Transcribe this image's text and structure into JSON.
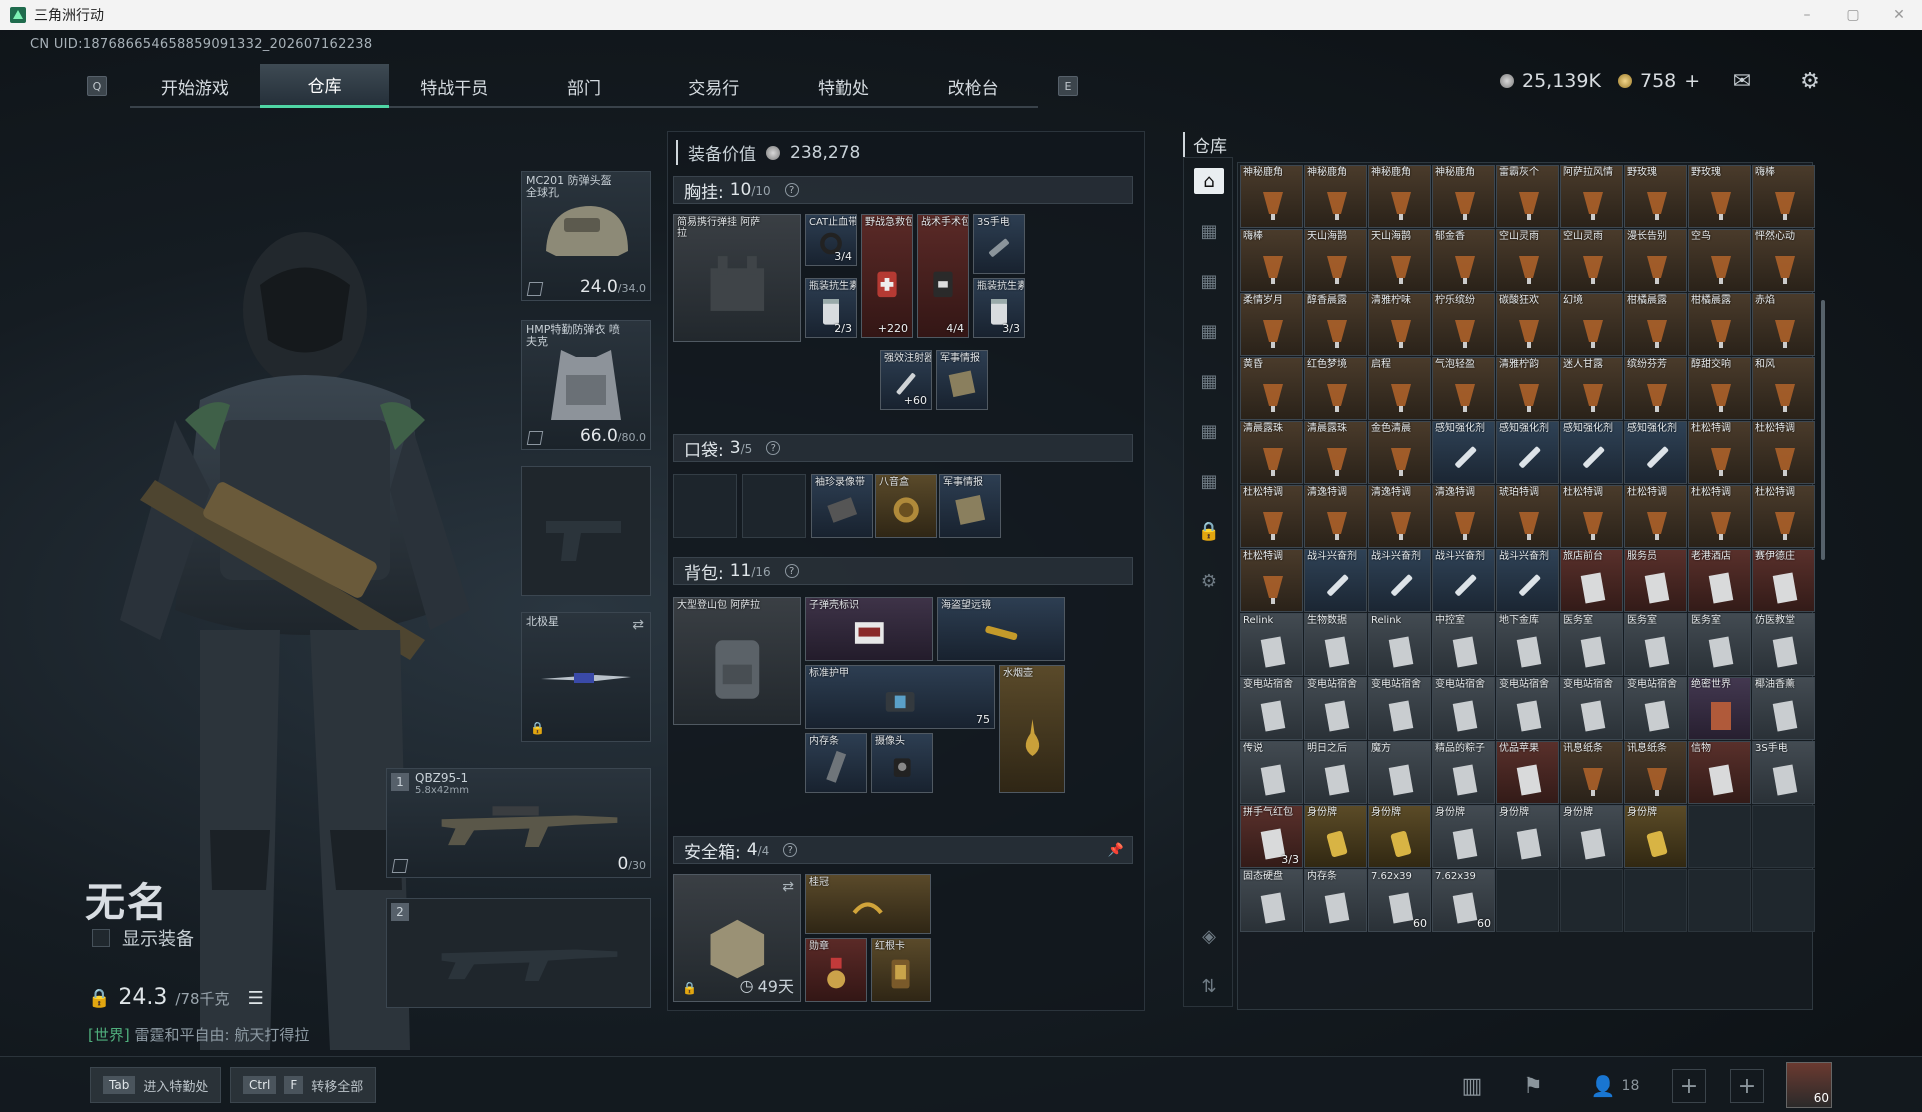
{
  "window": {
    "title": "三角洲行动",
    "min": "–",
    "max": "▢",
    "close": "✕"
  },
  "uid": "CN UID:18768665465885909​1332_202607162238",
  "nav": {
    "left_key": "Q",
    "right_key": "E",
    "tabs": [
      {
        "label": "开始游戏",
        "active": false
      },
      {
        "label": "仓库",
        "active": true
      },
      {
        "label": "特战干员",
        "active": false
      },
      {
        "label": "部门",
        "active": false
      },
      {
        "label": "交易行",
        "active": false
      },
      {
        "label": "特勤处",
        "active": false,
        "alert": "!"
      },
      {
        "label": "改枪台",
        "active": false
      }
    ]
  },
  "currency": {
    "silver": "25,139K",
    "gold": "758",
    "gold_add": "+"
  },
  "character": {
    "name": "无名",
    "show_equip_label": "显示装备",
    "weight_value": "24.3",
    "weight_unit": "/78千克",
    "chat_channel": "[世界]",
    "chat_text": "雷霆和平自由: 航天打得拉"
  },
  "slots": {
    "helmet": {
      "name": "MC201 防弹头盔 全球孔",
      "dur": "24.0",
      "max": "/34.0"
    },
    "armor": {
      "name": "HMP特勤防弹衣 喷夫克",
      "dur": "66.0",
      "max": "/80.0"
    },
    "melee": {
      "name": "北极星"
    },
    "weapon1": {
      "index": "1",
      "name": "QBZ95-1",
      "caliber": "5.8x42mm",
      "ammo": "0",
      "ammo_max": "/30"
    },
    "weapon2": {
      "index": "2"
    }
  },
  "equip": {
    "value_label": "装备价值",
    "value": "238,278",
    "chest": {
      "label": "胸挂:",
      "count": "10",
      "max": "/10",
      "rig_name": "简易携行弹挂 阿萨拉",
      "items": [
        {
          "name": "CAT止血带",
          "qty": "3/4"
        },
        {
          "name": "野战急救包",
          "qty": "+220"
        },
        {
          "name": "战术手术包",
          "qty": "4/4"
        },
        {
          "name": "3S手电"
        },
        {
          "name": "瓶装抗生素",
          "qty": "2/3"
        },
        {
          "name": "瓶装抗生素",
          "qty": "3/3"
        },
        {
          "name": "强效注射器",
          "qty": "+60"
        },
        {
          "name": "军事情报"
        }
      ]
    },
    "pocket": {
      "label": "口袋:",
      "count": "3",
      "max": "/5",
      "items": [
        {
          "name": "袖珍录像带"
        },
        {
          "name": "八音盒"
        },
        {
          "name": "军事情报"
        }
      ]
    },
    "backpack": {
      "label": "背包:",
      "count": "11",
      "max": "/16",
      "bag_name": "大型登山包 阿萨拉",
      "items": [
        {
          "name": "子弹壳标识"
        },
        {
          "name": "海盗望远镜"
        },
        {
          "name": "标准护甲",
          "qty": "75"
        },
        {
          "name": "水烟壶"
        },
        {
          "name": "内存条"
        },
        {
          "name": "摄像头"
        }
      ]
    },
    "safe": {
      "label": "安全箱:",
      "count": "4",
      "max": "/4",
      "days": "49天",
      "items": [
        {
          "name": "桂冠"
        },
        {
          "name": "勋章"
        },
        {
          "name": "红根卡"
        }
      ]
    }
  },
  "warehouse": {
    "title": "仓库",
    "cells": [
      {
        "n": "神秘鹿角",
        "c": "c-brown"
      },
      {
        "n": "神秘鹿角",
        "c": "c-brown"
      },
      {
        "n": "神秘鹿角",
        "c": "c-brown"
      },
      {
        "n": "神秘鹿角",
        "c": "c-brown"
      },
      {
        "n": "雷霸灰个",
        "c": "c-brown"
      },
      {
        "n": "阿萨拉风情",
        "c": "c-brown"
      },
      {
        "n": "野玫瑰",
        "c": "c-brown"
      },
      {
        "n": "野玫瑰",
        "c": "c-brown"
      },
      {
        "n": "嗨棒",
        "c": "c-brown"
      },
      {
        "n": "嗨棒",
        "c": "c-brown"
      },
      {
        "n": "天山海鹊",
        "c": "c-brown"
      },
      {
        "n": "天山海鹊",
        "c": "c-brown"
      },
      {
        "n": "郁金香",
        "c": "c-brown"
      },
      {
        "n": "空山灵雨",
        "c": "c-brown"
      },
      {
        "n": "空山灵雨",
        "c": "c-brown"
      },
      {
        "n": "漫长告别",
        "c": "c-brown"
      },
      {
        "n": "空鸟",
        "c": "c-brown"
      },
      {
        "n": "怦然心动",
        "c": "c-brown"
      },
      {
        "n": "柔情岁月",
        "c": "c-brown"
      },
      {
        "n": "醇香晨露",
        "c": "c-brown"
      },
      {
        "n": "清雅柠味",
        "c": "c-brown"
      },
      {
        "n": "柠乐缤纷",
        "c": "c-brown"
      },
      {
        "n": "碳酸狂欢",
        "c": "c-brown"
      },
      {
        "n": "幻境",
        "c": "c-brown"
      },
      {
        "n": "柑橘晨露",
        "c": "c-brown"
      },
      {
        "n": "柑橘晨露",
        "c": "c-brown"
      },
      {
        "n": "赤焰",
        "c": "c-brown"
      },
      {
        "n": "黄昏",
        "c": "c-brown"
      },
      {
        "n": "红色梦境",
        "c": "c-brown"
      },
      {
        "n": "启程",
        "c": "c-brown"
      },
      {
        "n": "气泡轻盈",
        "c": "c-brown"
      },
      {
        "n": "清雅柠韵",
        "c": "c-brown"
      },
      {
        "n": "迷人甘露",
        "c": "c-brown"
      },
      {
        "n": "缤纷芬芳",
        "c": "c-brown"
      },
      {
        "n": "醇甜交响",
        "c": "c-brown"
      },
      {
        "n": "和风",
        "c": "c-brown"
      },
      {
        "n": "清晨露珠",
        "c": "c-brown"
      },
      {
        "n": "清晨露珠",
        "c": "c-brown"
      },
      {
        "n": "金色清晨",
        "c": "c-brown"
      },
      {
        "n": "感知强化剂",
        "c": "c-blue"
      },
      {
        "n": "感知强化剂",
        "c": "c-blue"
      },
      {
        "n": "感知强化剂",
        "c": "c-blue"
      },
      {
        "n": "感知强化剂",
        "c": "c-blue"
      },
      {
        "n": "杜松特调",
        "c": "c-brown"
      },
      {
        "n": "杜松特调",
        "c": "c-brown"
      },
      {
        "n": "杜松特调",
        "c": "c-brown"
      },
      {
        "n": "清逸特调",
        "c": "c-brown"
      },
      {
        "n": "清逸特调",
        "c": "c-brown"
      },
      {
        "n": "清逸特调",
        "c": "c-brown"
      },
      {
        "n": "琥珀特调",
        "c": "c-brown"
      },
      {
        "n": "杜松特调",
        "c": "c-brown"
      },
      {
        "n": "杜松特调",
        "c": "c-brown"
      },
      {
        "n": "杜松特调",
        "c": "c-brown"
      },
      {
        "n": "杜松特调",
        "c": "c-brown"
      },
      {
        "n": "杜松特调",
        "c": "c-brown"
      },
      {
        "n": "战斗兴奋剂",
        "c": "c-blue"
      },
      {
        "n": "战斗兴奋剂",
        "c": "c-blue"
      },
      {
        "n": "战斗兴奋剂",
        "c": "c-blue"
      },
      {
        "n": "战斗兴奋剂",
        "c": "c-blue"
      },
      {
        "n": "旅店前台",
        "c": "c-red"
      },
      {
        "n": "服务员",
        "c": "c-red"
      },
      {
        "n": "老港酒店",
        "c": "c-red"
      },
      {
        "n": "赛伊德庄",
        "c": "c-red"
      },
      {
        "n": "Relink",
        "c": "c-gray"
      },
      {
        "n": "生物数据",
        "c": "c-gray"
      },
      {
        "n": "Relink",
        "c": "c-gray"
      },
      {
        "n": "中控室",
        "c": "c-gray"
      },
      {
        "n": "地下金库",
        "c": "c-gray"
      },
      {
        "n": "医务室",
        "c": "c-gray"
      },
      {
        "n": "医务室",
        "c": "c-gray"
      },
      {
        "n": "医务室",
        "c": "c-gray"
      },
      {
        "n": "仿医教堂",
        "c": "c-gray"
      },
      {
        "n": "变电站宿舍",
        "c": "c-gray"
      },
      {
        "n": "变电站宿舍",
        "c": "c-gray"
      },
      {
        "n": "变电站宿舍",
        "c": "c-gray"
      },
      {
        "n": "变电站宿舍",
        "c": "c-gray"
      },
      {
        "n": "变电站宿舍",
        "c": "c-gray"
      },
      {
        "n": "变电站宿舍",
        "c": "c-gray"
      },
      {
        "n": "变电站宿舍",
        "c": "c-gray"
      },
      {
        "n": "绝密世界",
        "c": "c-purple"
      },
      {
        "n": "椰油香薰",
        "c": "c-gray"
      },
      {
        "n": "传说",
        "c": "c-gray"
      },
      {
        "n": "明日之后",
        "c": "c-gray"
      },
      {
        "n": "魔方",
        "c": "c-gray"
      },
      {
        "n": "精品的粽子",
        "c": "c-gray"
      },
      {
        "n": "优品苹果",
        "c": "c-red"
      },
      {
        "n": "讯息纸条",
        "c": "c-brown"
      },
      {
        "n": "讯息纸条",
        "c": "c-brown"
      },
      {
        "n": "信物",
        "c": "c-red"
      },
      {
        "n": "3S手电",
        "c": "c-gray"
      },
      {
        "n": "拼手气红包",
        "c": "c-red",
        "q": "3/3"
      },
      {
        "n": "身份牌",
        "c": "c-gold"
      },
      {
        "n": "身份牌",
        "c": "c-gold"
      },
      {
        "n": "身份牌",
        "c": "c-gray"
      },
      {
        "n": "身份牌",
        "c": "c-gray"
      },
      {
        "n": "身份牌",
        "c": "c-gray"
      },
      {
        "n": "身份牌",
        "c": "c-gold"
      },
      {
        "n": "",
        "c": "c-empty"
      },
      {
        "n": "",
        "c": "c-empty"
      },
      {
        "n": "固态硬盘",
        "c": "c-gray"
      },
      {
        "n": "内存条",
        "c": "c-gray"
      },
      {
        "n": "7.62x39",
        "c": "c-gray",
        "q": "60"
      },
      {
        "n": "7.62x39",
        "c": "c-gray",
        "q": "60"
      },
      {
        "n": "",
        "c": "c-empty"
      },
      {
        "n": "",
        "c": "c-empty"
      },
      {
        "n": "",
        "c": "c-empty"
      },
      {
        "n": "",
        "c": "c-empty"
      },
      {
        "n": "",
        "c": "c-empty"
      }
    ]
  },
  "bottom": {
    "tab_key": "Tab",
    "tab_label": "进入特勤处",
    "ctrl_key": "Ctrl",
    "f_key": "F",
    "transfer_label": "转移全部",
    "friends_count": "18",
    "level": "60"
  }
}
